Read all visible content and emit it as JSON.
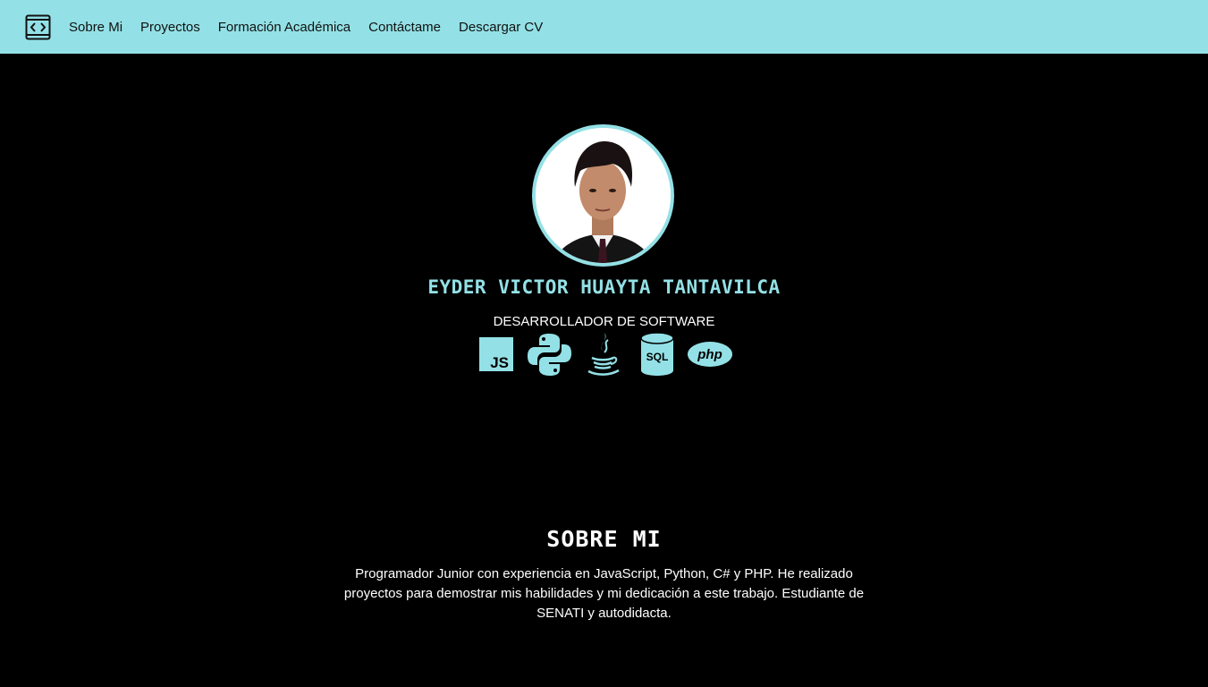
{
  "nav": {
    "brand_icon": "code-window-icon",
    "links": [
      "Sobre Mi",
      "Proyectos",
      "Formación Académica",
      "Contáctame",
      "Descargar CV"
    ]
  },
  "hero": {
    "avatar_alt": "profile-photo",
    "name": "EYDER VICTOR HUAYTA TANTAVILCA",
    "role": "DESARROLLADOR DE SOFTWARE",
    "skills": [
      {
        "icon": "javascript-icon",
        "label": "JS"
      },
      {
        "icon": "python-icon",
        "label": ""
      },
      {
        "icon": "java-icon",
        "label": ""
      },
      {
        "icon": "sql-icon",
        "label": "SQL"
      },
      {
        "icon": "php-icon",
        "label": "php"
      }
    ]
  },
  "about": {
    "title": "SOBRE MI",
    "text": "Programador Junior con experiencia en JavaScript, Python, C# y PHP. He realizado proyectos para demostrar mis habilidades y mi dedicación a este trabajo. Estudiante de SENATI y autodidacta."
  },
  "colors": {
    "accent": "#93e1e6",
    "background": "#000000",
    "nav_text": "#111111",
    "body_text": "#ffffff"
  }
}
